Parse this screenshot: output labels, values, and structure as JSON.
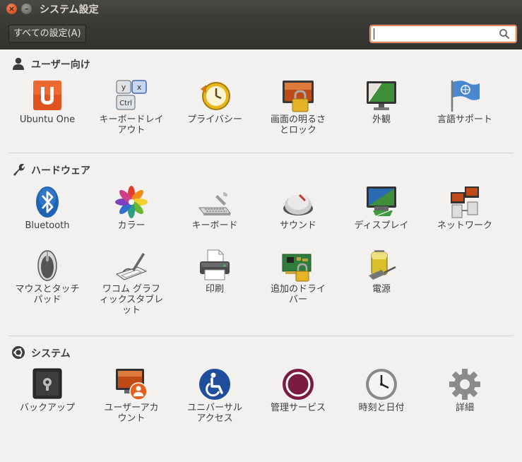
{
  "window": {
    "title": "システム設定"
  },
  "toolbar": {
    "all_settings_label": "すべての設定(A)",
    "search": {
      "value": "",
      "placeholder": ""
    }
  },
  "sections": [
    {
      "title": "ユーザー向け",
      "icon": "user-icon",
      "items": [
        {
          "label": "Ubuntu One",
          "icon": "ubuntu-one-icon"
        },
        {
          "label": "キーボードレイ\nアウト",
          "icon": "keyboard-layout-icon"
        },
        {
          "label": "プライバシー",
          "icon": "privacy-icon"
        },
        {
          "label": "画面の明るさ\nとロック",
          "icon": "brightness-lock-icon"
        },
        {
          "label": "外観",
          "icon": "appearance-icon"
        },
        {
          "label": "言語サポート",
          "icon": "language-support-icon"
        }
      ]
    },
    {
      "title": "ハードウェア",
      "icon": "wrench-icon",
      "items": [
        {
          "label": "Bluetooth",
          "icon": "bluetooth-icon"
        },
        {
          "label": "カラー",
          "icon": "color-icon"
        },
        {
          "label": "キーボード",
          "icon": "keyboard-icon"
        },
        {
          "label": "サウンド",
          "icon": "sound-icon"
        },
        {
          "label": "ディスプレイ",
          "icon": "display-icon"
        },
        {
          "label": "ネットワーク",
          "icon": "network-icon"
        },
        {
          "label": "マウスとタッチ\nパッド",
          "icon": "mouse-icon"
        },
        {
          "label": "ワコム グラフ\nィックスタブレ\nット",
          "icon": "wacom-tablet-icon"
        },
        {
          "label": "印刷",
          "icon": "printer-icon"
        },
        {
          "label": "追加のドライ\nバー",
          "icon": "additional-drivers-icon"
        },
        {
          "label": "電源",
          "icon": "power-icon"
        }
      ]
    },
    {
      "title": "システム",
      "icon": "system-icon",
      "items": [
        {
          "label": "バックアップ",
          "icon": "backup-icon"
        },
        {
          "label": "ユーザーアカ\nウント",
          "icon": "user-accounts-icon"
        },
        {
          "label": "ユニバーサル\nアクセス",
          "icon": "universal-access-icon"
        },
        {
          "label": "管理サービス",
          "icon": "landscape-service-icon"
        },
        {
          "label": "時刻と日付",
          "icon": "time-date-icon"
        },
        {
          "label": "詳細",
          "icon": "details-icon"
        }
      ]
    }
  ],
  "colors": {
    "titlebar": "#3c3b37",
    "background": "#f2f1f0",
    "accent": "#e2672f"
  }
}
